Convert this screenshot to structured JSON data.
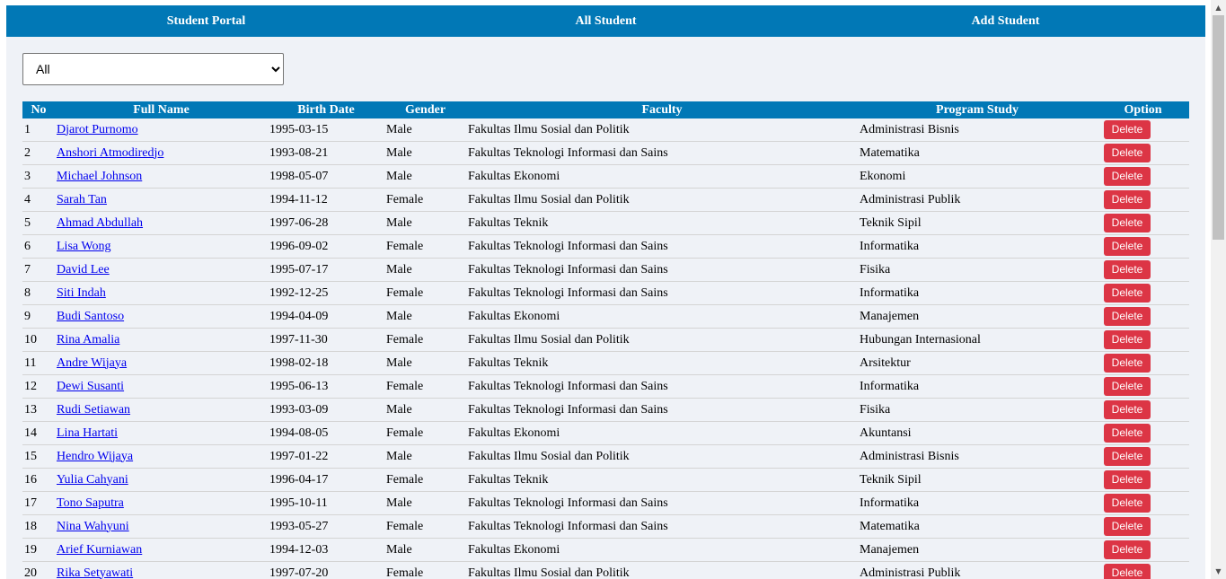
{
  "nav": {
    "items": [
      {
        "label": "Student Portal"
      },
      {
        "label": "All Student"
      },
      {
        "label": "Add Student"
      }
    ]
  },
  "filter": {
    "selected": "All",
    "options": [
      "All"
    ]
  },
  "table": {
    "headers": [
      "No",
      "Full Name",
      "Birth Date",
      "Gender",
      "Faculty",
      "Program Study",
      "Option"
    ],
    "delete_label": "Delete",
    "rows": [
      {
        "no": "1",
        "name": "Djarot Purnomo",
        "birth": "1995-03-15",
        "gender": "Male",
        "faculty": "Fakultas Ilmu Sosial dan Politik",
        "program": "Administrasi Bisnis"
      },
      {
        "no": "2",
        "name": "Anshori Atmodiredjo",
        "birth": "1993-08-21",
        "gender": "Male",
        "faculty": "Fakultas Teknologi Informasi dan Sains",
        "program": "Matematika"
      },
      {
        "no": "3",
        "name": "Michael Johnson",
        "birth": "1998-05-07",
        "gender": "Male",
        "faculty": "Fakultas Ekonomi",
        "program": "Ekonomi"
      },
      {
        "no": "4",
        "name": "Sarah Tan",
        "birth": "1994-11-12",
        "gender": "Female",
        "faculty": "Fakultas Ilmu Sosial dan Politik",
        "program": "Administrasi Publik"
      },
      {
        "no": "5",
        "name": "Ahmad Abdullah",
        "birth": "1997-06-28",
        "gender": "Male",
        "faculty": "Fakultas Teknik",
        "program": "Teknik Sipil"
      },
      {
        "no": "6",
        "name": "Lisa Wong",
        "birth": "1996-09-02",
        "gender": "Female",
        "faculty": "Fakultas Teknologi Informasi dan Sains",
        "program": "Informatika"
      },
      {
        "no": "7",
        "name": "David Lee",
        "birth": "1995-07-17",
        "gender": "Male",
        "faculty": "Fakultas Teknologi Informasi dan Sains",
        "program": "Fisika"
      },
      {
        "no": "8",
        "name": "Siti Indah",
        "birth": "1992-12-25",
        "gender": "Female",
        "faculty": "Fakultas Teknologi Informasi dan Sains",
        "program": "Informatika"
      },
      {
        "no": "9",
        "name": "Budi Santoso",
        "birth": "1994-04-09",
        "gender": "Male",
        "faculty": "Fakultas Ekonomi",
        "program": "Manajemen"
      },
      {
        "no": "10",
        "name": "Rina Amalia",
        "birth": "1997-11-30",
        "gender": "Female",
        "faculty": "Fakultas Ilmu Sosial dan Politik",
        "program": "Hubungan Internasional"
      },
      {
        "no": "11",
        "name": "Andre Wijaya",
        "birth": "1998-02-18",
        "gender": "Male",
        "faculty": "Fakultas Teknik",
        "program": "Arsitektur"
      },
      {
        "no": "12",
        "name": "Dewi Susanti",
        "birth": "1995-06-13",
        "gender": "Female",
        "faculty": "Fakultas Teknologi Informasi dan Sains",
        "program": "Informatika"
      },
      {
        "no": "13",
        "name": "Rudi Setiawan",
        "birth": "1993-03-09",
        "gender": "Male",
        "faculty": "Fakultas Teknologi Informasi dan Sains",
        "program": "Fisika"
      },
      {
        "no": "14",
        "name": "Lina Hartati",
        "birth": "1994-08-05",
        "gender": "Female",
        "faculty": "Fakultas Ekonomi",
        "program": "Akuntansi"
      },
      {
        "no": "15",
        "name": "Hendro Wijaya",
        "birth": "1997-01-22",
        "gender": "Male",
        "faculty": "Fakultas Ilmu Sosial dan Politik",
        "program": "Administrasi Bisnis"
      },
      {
        "no": "16",
        "name": "Yulia Cahyani",
        "birth": "1996-04-17",
        "gender": "Female",
        "faculty": "Fakultas Teknik",
        "program": "Teknik Sipil"
      },
      {
        "no": "17",
        "name": "Tono Saputra",
        "birth": "1995-10-11",
        "gender": "Male",
        "faculty": "Fakultas Teknologi Informasi dan Sains",
        "program": "Informatika"
      },
      {
        "no": "18",
        "name": "Nina Wahyuni",
        "birth": "1993-05-27",
        "gender": "Female",
        "faculty": "Fakultas Teknologi Informasi dan Sains",
        "program": "Matematika"
      },
      {
        "no": "19",
        "name": "Arief Kurniawan",
        "birth": "1994-12-03",
        "gender": "Male",
        "faculty": "Fakultas Ekonomi",
        "program": "Manajemen"
      },
      {
        "no": "20",
        "name": "Rika Setyawati",
        "birth": "1997-07-20",
        "gender": "Female",
        "faculty": "Fakultas Ilmu Sosial dan Politik",
        "program": "Administrasi Publik"
      }
    ]
  },
  "scrollbar": {
    "up_icon": "chevron-up-icon",
    "down_icon": "chevron-down-icon"
  },
  "colors": {
    "primary": "#0178b6",
    "background": "#eff2f7",
    "danger": "#dc3545"
  }
}
